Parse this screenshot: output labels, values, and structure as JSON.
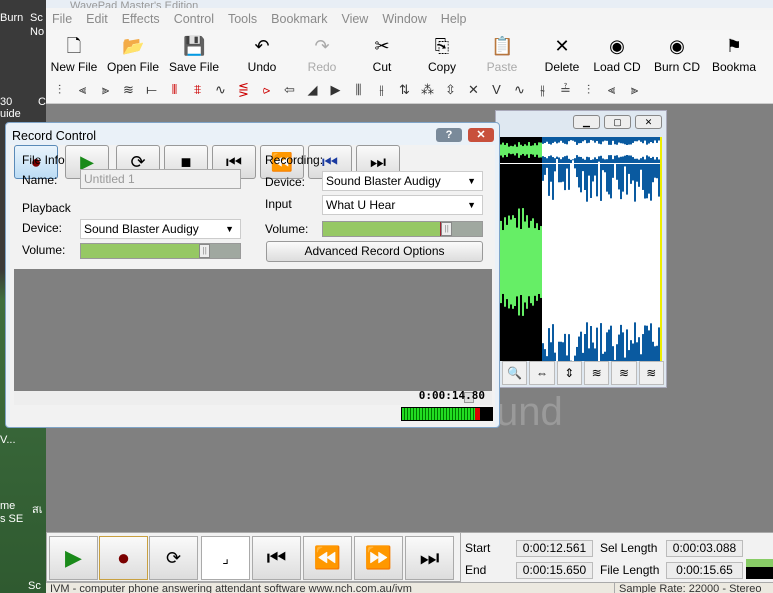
{
  "desktop": {
    "labels": [
      "Burn",
      "Sc",
      "No",
      "30",
      "uide",
      "C",
      "V...",
      "me",
      "s SE",
      "สเ",
      "Sc"
    ]
  },
  "app": {
    "title": "WavePad Master's Edition",
    "menu": [
      "File",
      "Edit",
      "Effects",
      "Control",
      "Tools",
      "Bookmark",
      "View",
      "Window",
      "Help"
    ],
    "toolbar": [
      {
        "label": "New File",
        "icon": "new-file-icon",
        "glyph": "🗋",
        "enabled": true
      },
      {
        "label": "Open File",
        "icon": "open-folder-icon",
        "glyph": "📂",
        "enabled": true
      },
      {
        "label": "Save File",
        "icon": "floppy-icon",
        "glyph": "💾",
        "enabled": true
      },
      {
        "label": "Undo",
        "icon": "undo-icon",
        "glyph": "↶",
        "enabled": true
      },
      {
        "label": "Redo",
        "icon": "redo-icon",
        "glyph": "↷",
        "enabled": false
      },
      {
        "label": "Cut",
        "icon": "scissors-icon",
        "glyph": "✂",
        "enabled": true
      },
      {
        "label": "Copy",
        "icon": "copy-icon",
        "glyph": "⎘",
        "enabled": true
      },
      {
        "label": "Paste",
        "icon": "paste-icon",
        "glyph": "📋",
        "enabled": false
      },
      {
        "label": "Delete",
        "icon": "delete-x-icon",
        "glyph": "✕",
        "enabled": true
      },
      {
        "label": "Load CD",
        "icon": "load-cd-icon",
        "glyph": "◉",
        "enabled": true
      },
      {
        "label": "Burn CD",
        "icon": "burn-cd-icon",
        "glyph": "◉",
        "enabled": true
      },
      {
        "label": "Bookma",
        "icon": "bookmark-icon",
        "glyph": "⚑",
        "enabled": true
      }
    ],
    "effects_toolbar_count": 26,
    "watermark": "und"
  },
  "record_dialog": {
    "title": "Record Control",
    "help": "?",
    "close": "✕",
    "file_info": "File Info",
    "name_label": "Name:",
    "name_value": "Untitled 1",
    "playback": "Playback",
    "pb_device_label": "Device:",
    "pb_device": "Sound Blaster Audigy",
    "pb_volume_label": "Volume:",
    "pb_volume_pct": 75,
    "recording": "Recording:",
    "rec_device_label": "Device:",
    "rec_device": "Sound Blaster Audigy",
    "input_label": "Input",
    "input_value": "What U Hear",
    "rec_volume_label": "Volume:",
    "rec_volume_pct": 75,
    "advanced": "Advanced Record Options",
    "time": "0:00:14.80",
    "meter_level_pct": 80
  },
  "time_panel": {
    "start_label": "Start",
    "start": "0:00:12.561",
    "end_label": "End",
    "end": "0:00:15.650",
    "sel_label": "Sel Length",
    "sel": "0:00:03.088",
    "file_label": "File Length",
    "file": "0:00:15.65"
  },
  "status": {
    "left": "IVM - computer phone answering attendant software www.nch.com.au/ivm",
    "right": "Sample Rate: 22000 - Stereo"
  },
  "colors": {
    "wave_green": "#66ee66",
    "selection_blue": "#0a5aa0",
    "record_red": "#7a0000",
    "play_green": "#1a8a1a"
  }
}
